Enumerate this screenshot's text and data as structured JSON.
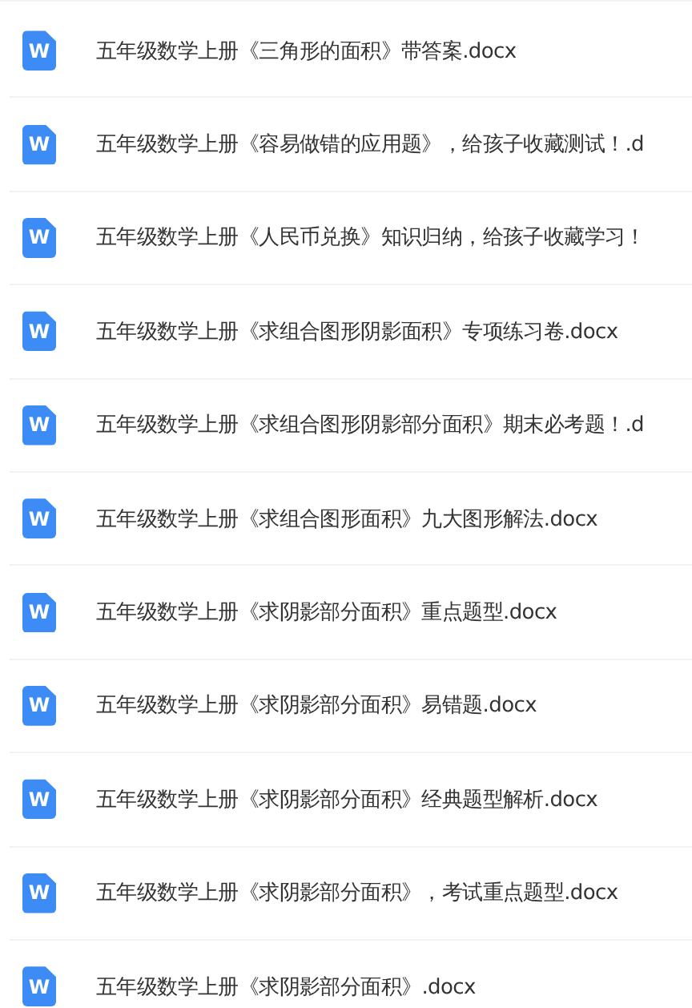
{
  "files": [
    {
      "icon_label": "W",
      "name": "五年级数学上册《三角形的面积》带答案.docx"
    },
    {
      "icon_label": "W",
      "name": "五年级数学上册《容易做错的应用题》，给孩子收藏测试！.d"
    },
    {
      "icon_label": "W",
      "name": "五年级数学上册《人民币兑换》知识归纳，给孩子收藏学习！"
    },
    {
      "icon_label": "W",
      "name": "五年级数学上册《求组合图形阴影面积》专项练习卷.docx"
    },
    {
      "icon_label": "W",
      "name": "五年级数学上册《求组合图形阴影部分面积》期末必考题！.d"
    },
    {
      "icon_label": "W",
      "name": "五年级数学上册《求组合图形面积》九大图形解法.docx"
    },
    {
      "icon_label": "W",
      "name": "五年级数学上册《求阴影部分面积》重点题型.docx"
    },
    {
      "icon_label": "W",
      "name": "五年级数学上册《求阴影部分面积》易错题.docx"
    },
    {
      "icon_label": "W",
      "name": "五年级数学上册《求阴影部分面积》经典题型解析.docx"
    },
    {
      "icon_label": "W",
      "name": "五年级数学上册《求阴影部分面积》，考试重点题型.docx"
    },
    {
      "icon_label": "W",
      "name": "五年级数学上册《求阴影部分面积》.docx"
    }
  ]
}
